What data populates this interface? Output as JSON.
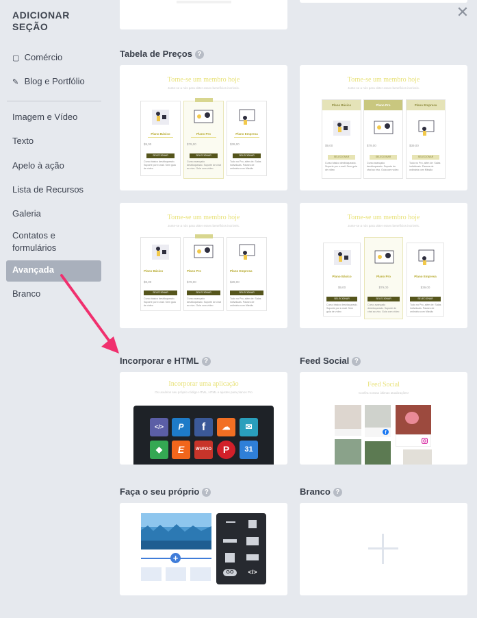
{
  "sidebar": {
    "title": "ADICIONAR SEÇÃO",
    "top_items": [
      {
        "label": "Comércio",
        "icon": "shopping-bag-icon",
        "glyph": "▢"
      },
      {
        "label": "Blog e Portfólio",
        "icon": "edit-icon",
        "glyph": "✎"
      }
    ],
    "items": [
      "Imagem e Vídeo",
      "Texto",
      "Apelo à ação",
      "Lista de Recursos",
      "Galeria",
      "Contatos e formulários",
      "Avançada",
      "Branco"
    ],
    "active": "Avançada"
  },
  "close_glyph": "✕",
  "sections": {
    "pricing": "Tabela de Preços",
    "embed": "Incorporar e HTML",
    "social": "Feed Social",
    "own": "Faça o seu próprio",
    "blank": "Branco"
  },
  "help_glyph": "?",
  "pricing_card": {
    "heading": "Torne-se um membro hoje",
    "subheading": "Junte-se a nós para obter esses benefícios incríveis.",
    "plans": [
      "Plano Básico",
      "Plano Pro",
      "Plano Empresa"
    ],
    "prices": [
      "$9,00",
      "$79,00",
      "$39,00"
    ],
    "button": "SELECIONAR",
    "descs": [
      "Curso básico desbloqueado. Suporte por e-mail. Sem guia de vídeo",
      "Curso avançado desbloqueado. Suporte de chat ao vivo. Guia com vídeo",
      "Tudo no Pro, além de: Salas individuais. Passes de ordinária com Missão"
    ]
  },
  "embed_card": {
    "heading": "Incorporar uma aplicação",
    "subheading": "Os usuários seu próprio código HTML, HTML e ajustes para planos Pro",
    "apps": [
      {
        "label": "</>",
        "color": "#5b5ea6",
        "icon": "code-icon"
      },
      {
        "label": "P",
        "color": "#1e7bc8",
        "icon": "paypal-icon"
      },
      {
        "label": "f",
        "color": "#3b5998",
        "icon": "facebook-icon"
      },
      {
        "label": "☁",
        "color": "#f26f23",
        "icon": "soundcloud-icon"
      },
      {
        "label": "✉",
        "color": "#2a9fbc",
        "icon": "mailchimp-icon"
      },
      {
        "label": "◆",
        "color": "#34a853",
        "icon": "google-maps-icon"
      },
      {
        "label": "E",
        "color": "#f1661c",
        "icon": "eventbrite-icon"
      },
      {
        "label": "WUFOO",
        "color": "#c8342a",
        "icon": "wufoo-icon"
      },
      {
        "label": "P",
        "color": "#d1202a",
        "icon": "pinterest-icon"
      },
      {
        "label": "31",
        "color": "#2f7fd8",
        "icon": "calendar-icon"
      }
    ]
  },
  "social_card": {
    "heading": "Feed Social",
    "subheading": "Confira nossas últimas atualizações!"
  },
  "own_card": {
    "go_label": "GO",
    "code_label": "</>"
  },
  "colors": {
    "accent_arrow": "#f0306e",
    "sidebar_active": "#a9b0bc"
  }
}
